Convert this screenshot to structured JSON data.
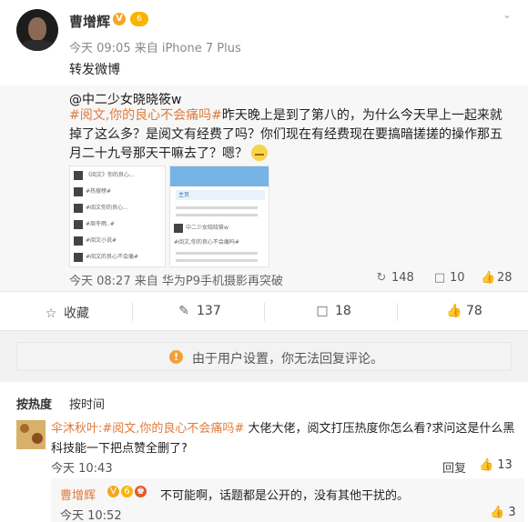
{
  "post": {
    "author": "曹增辉",
    "meta": "今天 09:05 来自 iPhone 7 Plus",
    "text": "转发微博",
    "verified_badge": "V",
    "vip_badge": "6"
  },
  "quote": {
    "user": "@中二少女晓晓筱w",
    "tag": "#阅文,你的良心不会痛吗#",
    "body": "昨天晚上是到了第八的，为什么今天早上一起来就掉了这么多？是阅文有经费了吗？你们现在有经费现在要搞暗搓搓的操作那五月二十九号那天干嘛去了？嗯？",
    "meta": "今天 08:27 来自 华为P9手机摄影再突破",
    "reposts": "148",
    "comments": "10",
    "likes": "28",
    "thumb_a_rows": [
      "《阅文》你的良心...",
      "#热搜榜#",
      "#阅文你的良心...",
      "#周冬雨..#",
      "#阅文小说#",
      "#阅文的良心不会痛#"
    ],
    "thumb_b_tab": "主页",
    "thumb_b_rows": [
      "中二少女晓晓筱w",
      "#阅文,你的良心不会痛吗#"
    ]
  },
  "actions": {
    "repost_label": "收藏",
    "forward_count": "137",
    "comment_count": "18",
    "like_count": "78"
  },
  "notice": {
    "text": "由于用户设置，你无法回复评论。"
  },
  "comments": {
    "sort_hot": "按热度",
    "sort_time": "按时间",
    "items": [
      {
        "user": "伞沐秋叶:",
        "tag": "#阅文,你的良心不会痛吗#",
        "text": " 大佬大佬，阅文打压热度你怎么看?求问这是什么黑科技能一下把点赞全删了?",
        "time": "今天 10:43",
        "reply": "回复",
        "likes": "13"
      }
    ],
    "reply": {
      "user": "曹增辉",
      "text": "不可能啊，话题都是公开的，没有其他干扰的。",
      "time": "今天 10:52",
      "likes": "3"
    }
  }
}
